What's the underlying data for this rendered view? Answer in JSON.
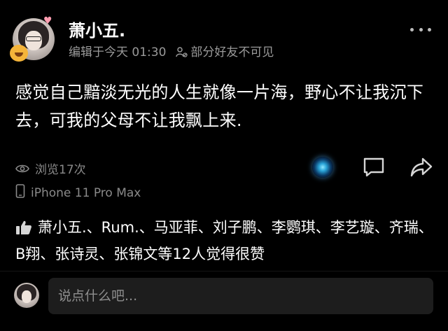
{
  "post": {
    "author": "萧小五.",
    "edited_time": "编辑于今天 01:30",
    "visibility": "部分好友不可见",
    "content": "感觉自己黯淡无光的人生就像一片海，野心不让我沉下去，可我的父母不让我飘上来.",
    "views": "浏览17次",
    "device": "iPhone 11 Pro Max"
  },
  "likes": {
    "text": "萧小五.、Rum.、马亚菲、刘子鹏、李鹦琪、李艺璇、齐瑞、B翔、张诗灵、张锦文等12人觉得很赞"
  },
  "comment_box": {
    "placeholder": "说点什么吧..."
  },
  "colors": {
    "background": "#000000",
    "text_primary": "#ffffff",
    "text_secondary": "#9a9a9a",
    "input_bg": "#1d1d1d"
  },
  "icons": {
    "more": "more-dots-icon",
    "visibility": "people-icon",
    "views": "eye-icon",
    "device": "phone-icon",
    "decoration": "glowing-orb-icon",
    "comment": "comment-icon",
    "share": "share-icon",
    "like": "thumbs-up-icon"
  }
}
